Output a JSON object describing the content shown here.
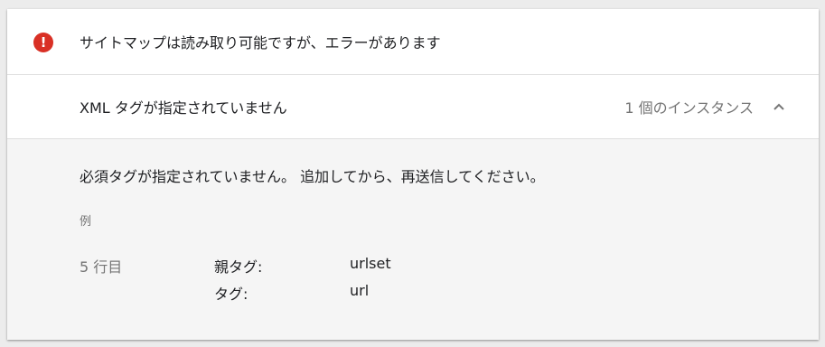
{
  "status": {
    "icon": "error-icon",
    "icon_color": "#d93025",
    "icon_glyph": "!",
    "text": "サイトマップは読み取り可能ですが、エラーがあります"
  },
  "issue": {
    "title": "XML タグが指定されていません",
    "count": "1 個のインスタンス",
    "toggle_icon": "chevron-up-icon"
  },
  "details": {
    "message": "必須タグが指定されていません。 追加してから、再送信してください。",
    "example_label": "例",
    "line": "5 行目",
    "attributes": [
      {
        "name": "親タグ:",
        "value": "urlset"
      },
      {
        "name": "タグ:",
        "value": "url"
      }
    ]
  }
}
